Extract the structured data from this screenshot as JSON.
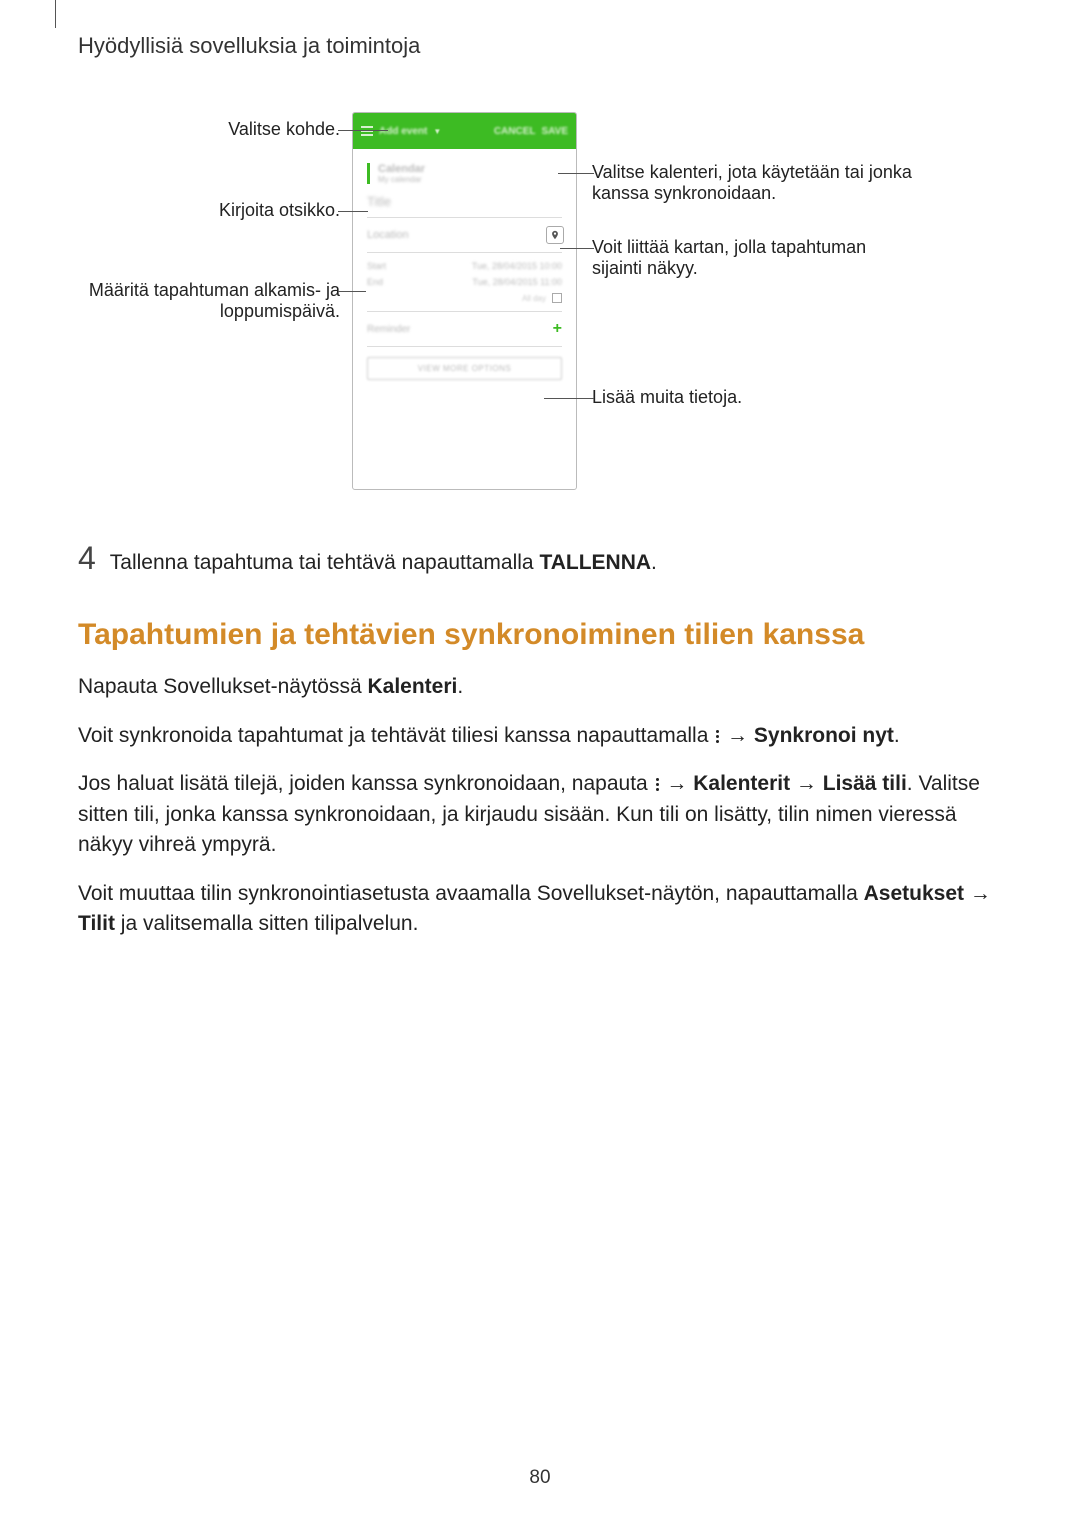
{
  "header": {
    "chapter": "Hyödyllisiä sovelluksia ja toimintoja"
  },
  "phone": {
    "topbar_add": "Add event",
    "topbar_cancel": "CANCEL",
    "topbar_save": "SAVE",
    "cal_title": "Calendar",
    "cal_sub": "My calendar",
    "title_field": "Title",
    "location": "Location",
    "start_label": "Start",
    "start_value": "Tue, 28/04/2015   10:00",
    "end_label": "End",
    "end_value": "Tue, 28/04/2015   11:00",
    "allday": "All day",
    "reminder": "Reminder",
    "more": "VIEW MORE OPTIONS"
  },
  "callouts": {
    "target": "Valitse kohde.",
    "calendar": "Valitse kalenteri, jota käytetään tai jonka kanssa synkronoidaan.",
    "title": "Kirjoita otsikko.",
    "location": "Voit liittää kartan, jolla tapahtuman sijainti näkyy.",
    "dates": "Määritä tapahtuman alkamis- ja loppumispäivä.",
    "more": "Lisää muita tietoja."
  },
  "step4": {
    "num": "4",
    "text_before": "Tallenna tapahtuma tai tehtävä napauttamalla ",
    "save_bold": "TALLENNA",
    "text_after": "."
  },
  "section": {
    "heading": "Tapahtumien ja tehtävien synkronoiminen tilien kanssa",
    "p1_before": "Napauta Sovellukset-näytössä ",
    "p1_bold": "Kalenteri",
    "p1_after": ".",
    "p2_before": "Voit synkronoida tapahtumat ja tehtävät tiliesi kanssa napauttamalla ",
    "p2_arrow": " → ",
    "p2_bold": "Synkronoi nyt",
    "p2_after": ".",
    "p3_before": "Jos haluat lisätä tilejä, joiden kanssa synkronoidaan, napauta ",
    "p3_arrow1": " → ",
    "p3_bold1": "Kalenterit",
    "p3_arrow2": " → ",
    "p3_bold2": "Lisää tili",
    "p3_after": ". Valitse sitten tili, jonka kanssa synkronoidaan, ja kirjaudu sisään. Kun tili on lisätty, tilin nimen vieressä näkyy vihreä ympyrä.",
    "p4_before": "Voit muuttaa tilin synkronointiasetusta avaamalla Sovellukset-näytön, napauttamalla ",
    "p4_bold1": "Asetukset",
    "p4_arrow": " → ",
    "p4_bold2": "Tilit",
    "p4_after": " ja valitsemalla sitten tilipalvelun."
  },
  "page_number": "80"
}
